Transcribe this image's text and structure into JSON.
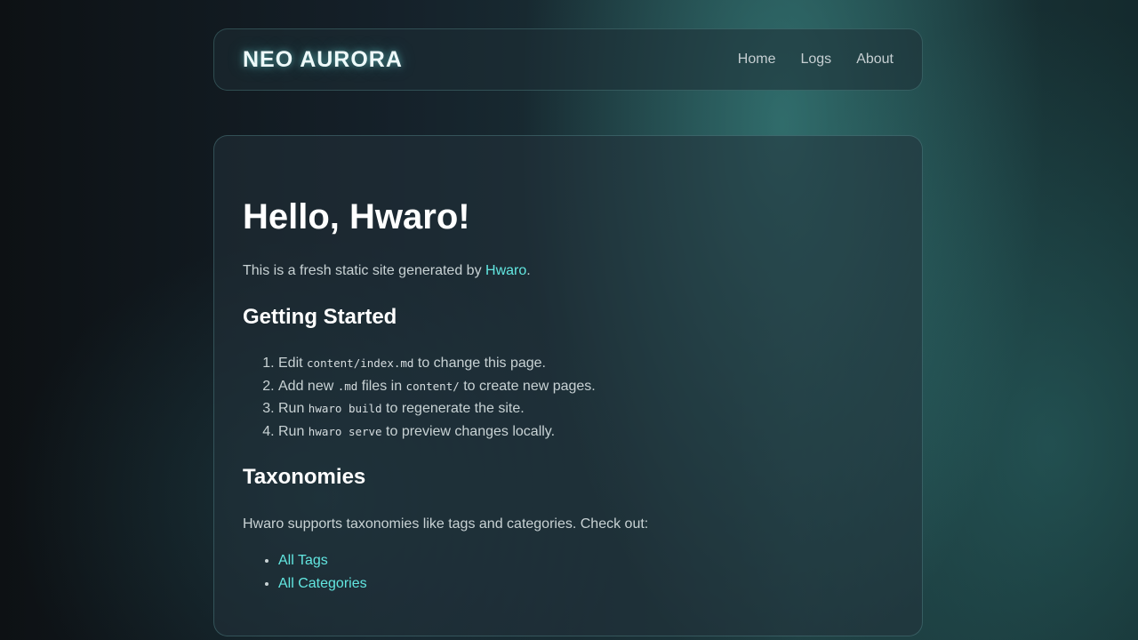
{
  "header": {
    "brand": "NEO AURORA",
    "nav": [
      "Home",
      "Logs",
      "About"
    ]
  },
  "main": {
    "title": "Hello, Hwaro!",
    "intro_prefix": "This is a fresh static site generated by ",
    "intro_link": "Hwaro",
    "intro_suffix": ".",
    "getting_started": {
      "heading": "Getting Started",
      "steps": [
        {
          "pre": "Edit ",
          "code": "content/index.md",
          "post": " to change this page."
        },
        {
          "pre": "Add new ",
          "code": ".md",
          "mid": " files in ",
          "code2": "content/",
          "post": " to create new pages."
        },
        {
          "pre": "Run ",
          "code": "hwaro build",
          "post": " to regenerate the site."
        },
        {
          "pre": "Run ",
          "code": "hwaro serve",
          "post": " to preview changes locally."
        }
      ]
    },
    "taxonomies": {
      "heading": "Taxonomies",
      "text": "Hwaro supports taxonomies like tags and categories. Check out:",
      "links": [
        "All Tags",
        "All Categories"
      ]
    }
  },
  "colors": {
    "accent": "#62e6e0",
    "heading": "#ffffff",
    "text": "#c8d2d4"
  }
}
